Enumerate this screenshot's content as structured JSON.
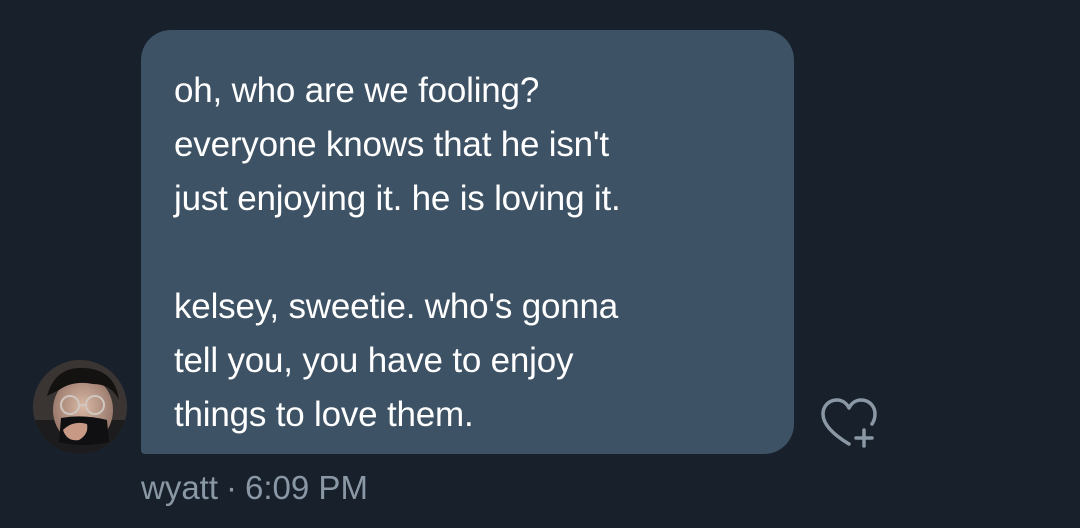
{
  "message": {
    "text": "oh, who are we fooling?\neveryone knows that he isn't\njust enjoying it. he is loving it.\n\nkelsey, sweetie. who's gonna\ntell you, you have to enjoy\nthings to love them.",
    "sender": "wyatt",
    "separator": "·",
    "time": "6:09 PM"
  },
  "icons": {
    "avatar": "user-avatar",
    "react": "heart-plus-icon"
  },
  "colors": {
    "background": "#18202b",
    "bubble": "#3d5264",
    "text": "#ffffff",
    "meta_text": "#8a98a6",
    "icon": "#8a98a6"
  }
}
